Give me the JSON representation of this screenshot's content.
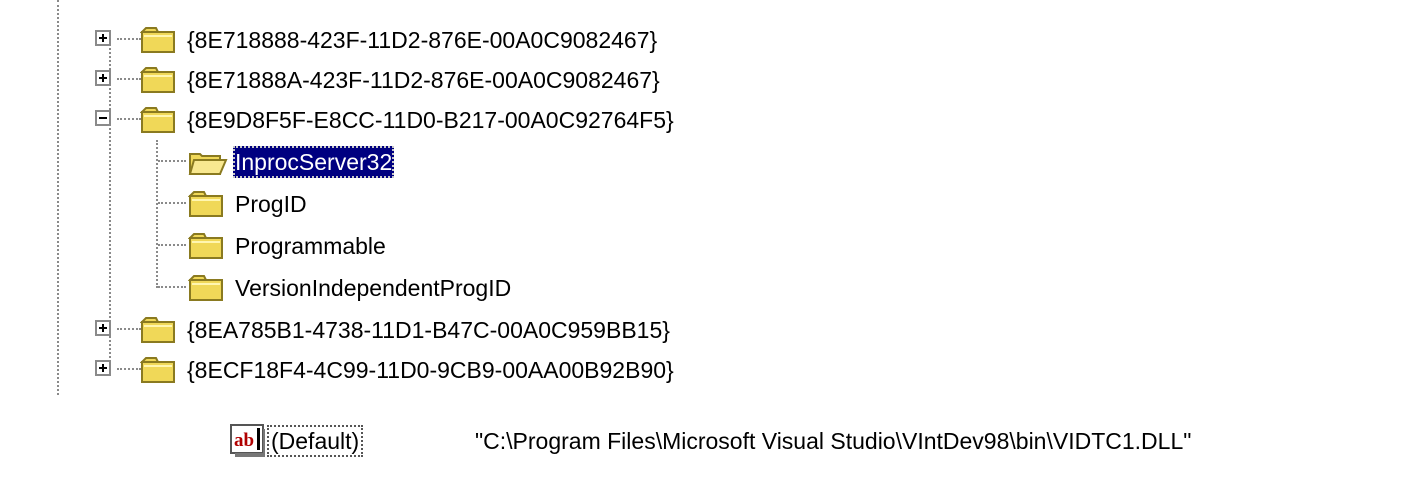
{
  "tree": {
    "nodes": [
      {
        "label": "{8E718888-423F-11D2-876E-00A0C9082467}",
        "expander": "plus",
        "selected": false,
        "folder_state": "closed",
        "icon": "folder-icon"
      },
      {
        "label": "{8E71888A-423F-11D2-876E-00A0C9082467}",
        "expander": "plus",
        "selected": false,
        "folder_state": "closed",
        "icon": "folder-icon"
      },
      {
        "label": "{8E9D8F5F-E8CC-11D0-B217-00A0C92764F5}",
        "expander": "minus",
        "selected": false,
        "folder_state": "closed",
        "icon": "folder-icon"
      },
      {
        "label": "InprocServer32",
        "expander": "none",
        "selected": true,
        "folder_state": "open",
        "icon": "open-folder-icon"
      },
      {
        "label": "ProgID",
        "expander": "none",
        "selected": false,
        "folder_state": "closed",
        "icon": "folder-icon"
      },
      {
        "label": "Programmable",
        "expander": "none",
        "selected": false,
        "folder_state": "closed",
        "icon": "folder-icon"
      },
      {
        "label": "VersionIndependentProgID",
        "expander": "none",
        "selected": false,
        "folder_state": "closed",
        "icon": "folder-icon"
      },
      {
        "label": "{8EA785B1-4738-11D1-B47C-00A0C959BB15}",
        "expander": "plus",
        "selected": false,
        "folder_state": "closed",
        "icon": "folder-icon"
      },
      {
        "label": "{8ECF18F4-4C99-11D0-9CB9-00AA00B92B90}",
        "expander": "plus",
        "selected": false,
        "folder_state": "closed",
        "icon": "folder-icon"
      }
    ]
  },
  "value_pane": {
    "icon": "string-value-ab-icon",
    "name": "(Default)",
    "data": "\"C:\\Program Files\\Microsoft Visual Studio\\VIntDev98\\bin\\VIDTC1.DLL\""
  },
  "colors": {
    "selection_bg": "#000080",
    "selection_fg": "#ffffff",
    "folder_yellow": "#f0d858",
    "tree_lines": "#8a8a8a"
  }
}
